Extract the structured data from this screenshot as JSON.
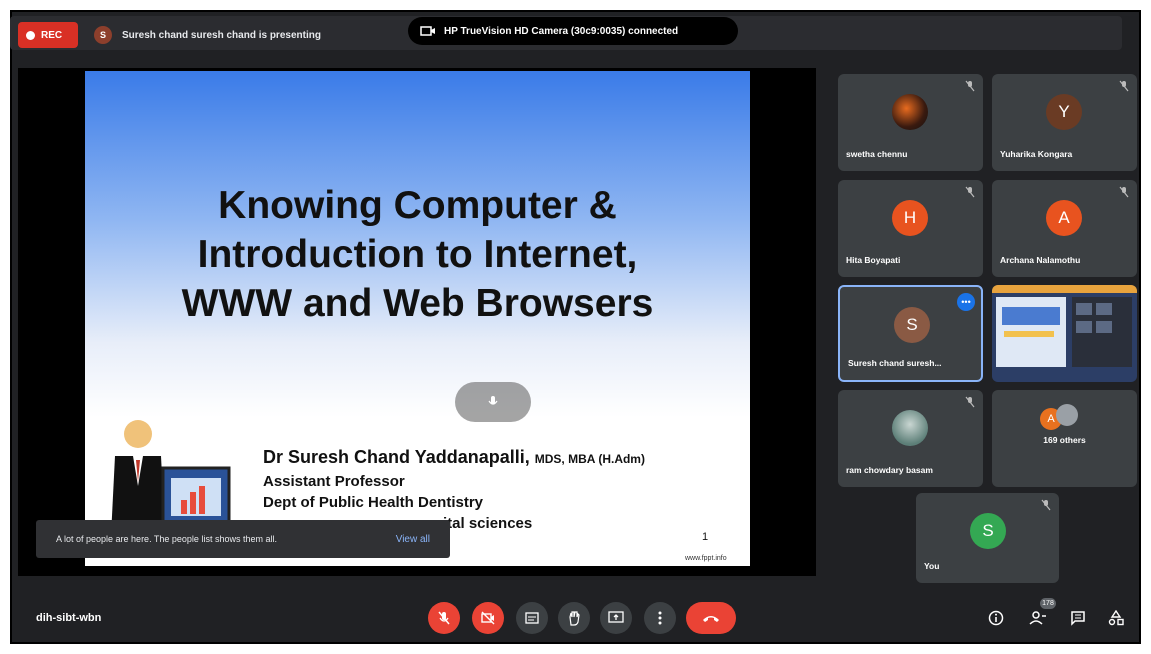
{
  "top_bar": {
    "rec_label": "REC",
    "presenter_initial": "S",
    "presenting_text": "Suresh chand suresh chand is presenting",
    "camera_text": "HP TrueVision HD Camera (30c9:0035)  connected"
  },
  "slide": {
    "title_line1": "Knowing Computer &",
    "title_line2": "Introduction to Internet,",
    "title_line3": "WWW and Web Browsers",
    "author_name": "Dr Suresh Chand Yaddanapalli,",
    "author_degrees": "MDS, MBA (H.Adm)",
    "line1": "Assistant Professor",
    "line2": "Dept of Public Health Dentistry",
    "line3_partial": "ital sciences",
    "page_number": "1",
    "url": "www.fppt.info"
  },
  "toast": {
    "message": "A lot of people are here. The people list shows them all.",
    "link": "View all"
  },
  "participants": [
    {
      "name": "swetha chennu",
      "initial": "",
      "color": "#5c2b1a",
      "muted": true
    },
    {
      "name": "Yuharika Kongara",
      "initial": "Y",
      "color": "#6a3b24",
      "muted": true
    },
    {
      "name": "Hita Boyapati",
      "initial": "H",
      "color": "#e8531f",
      "muted": true
    },
    {
      "name": "Archana Nalamothu",
      "initial": "A",
      "color": "#e8531f",
      "muted": true
    },
    {
      "name": "Suresh chand suresh...",
      "initial": "S",
      "color": "#8a5a44",
      "muted": false
    },
    {
      "name": "",
      "initial": "",
      "color": "#9aa6b8",
      "muted": false
    },
    {
      "name": "ram chowdary basam",
      "initial": "",
      "color": "#6f8f8a",
      "muted": true
    },
    {
      "name": "169 others",
      "initial": "A",
      "color": "#e8711f",
      "muted": false
    },
    {
      "name": "You",
      "initial": "S",
      "color": "#34a853",
      "muted": true
    }
  ],
  "bottom_bar": {
    "meeting_code": "dih-sibt-wbn",
    "people_count": "178"
  },
  "colors": {
    "accent_red": "#ea4335",
    "tile_bg": "#3c4043",
    "active_border": "#8ab4f8"
  }
}
